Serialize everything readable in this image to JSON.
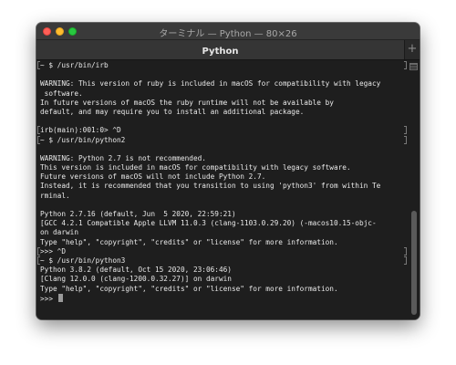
{
  "window": {
    "title": "ターミナル — Python — 80×26"
  },
  "tabs": [
    {
      "label": "Python"
    }
  ],
  "new_tab_label": "+",
  "terminal": {
    "lines": [
      {
        "text": "~ $ /usr/bin/irb",
        "open": true,
        "close": true
      },
      {
        "text": "",
        "open": false,
        "close": false
      },
      {
        "text": "WARNING: This version of ruby is included in macOS for compatibility with legacy",
        "open": false,
        "close": false
      },
      {
        "text": " software.",
        "open": false,
        "close": false
      },
      {
        "text": "In future versions of macOS the ruby runtime will not be available by",
        "open": false,
        "close": false
      },
      {
        "text": "default, and may require you to install an additional package.",
        "open": false,
        "close": false
      },
      {
        "text": "",
        "open": false,
        "close": false
      },
      {
        "text": "irb(main):001:0> ^D",
        "open": true,
        "close": true
      },
      {
        "text": "~ $ /usr/bin/python2",
        "open": true,
        "close": true
      },
      {
        "text": "",
        "open": false,
        "close": false
      },
      {
        "text": "WARNING: Python 2.7 is not recommended.",
        "open": false,
        "close": false
      },
      {
        "text": "This version is included in macOS for compatibility with legacy software.",
        "open": false,
        "close": false
      },
      {
        "text": "Future versions of macOS will not include Python 2.7.",
        "open": false,
        "close": false
      },
      {
        "text": "Instead, it is recommended that you transition to using 'python3' from within Te",
        "open": false,
        "close": false
      },
      {
        "text": "rminal.",
        "open": false,
        "close": false
      },
      {
        "text": "",
        "open": false,
        "close": false
      },
      {
        "text": "Python 2.7.16 (default, Jun  5 2020, 22:59:21)",
        "open": false,
        "close": false
      },
      {
        "text": "[GCC 4.2.1 Compatible Apple LLVM 11.0.3 (clang-1103.0.29.20) (-macos10.15-objc-",
        "open": false,
        "close": false
      },
      {
        "text": "on darwin",
        "open": false,
        "close": false
      },
      {
        "text": "Type \"help\", \"copyright\", \"credits\" or \"license\" for more information.",
        "open": false,
        "close": false
      },
      {
        "text": ">>> ^D",
        "open": true,
        "close": true
      },
      {
        "text": "~ $ /usr/bin/python3",
        "open": true,
        "close": true
      },
      {
        "text": "Python 3.8.2 (default, Oct 15 2020, 23:06:46)",
        "open": false,
        "close": false
      },
      {
        "text": "[Clang 12.0.0 (clang-1200.0.32.27)] on darwin",
        "open": false,
        "close": false
      },
      {
        "text": "Type \"help\", \"copyright\", \"credits\" or \"license\" for more information.",
        "open": false,
        "close": false
      },
      {
        "text": ">>> ",
        "open": false,
        "close": false,
        "cursor": true
      }
    ]
  },
  "colors": {
    "terminal_background": "#1e1e1e",
    "terminal_text": "#e8e8e8",
    "titlebar": "#3a3a3a",
    "traffic_close": "#fe5f57",
    "traffic_minimize": "#febc2e",
    "traffic_maximize": "#28c840"
  },
  "icons": {
    "close": "close-icon",
    "minimize": "minimize-icon",
    "maximize": "maximize-icon",
    "new_tab": "plus-icon",
    "scroll_marker": "scroll-marker-icon"
  }
}
